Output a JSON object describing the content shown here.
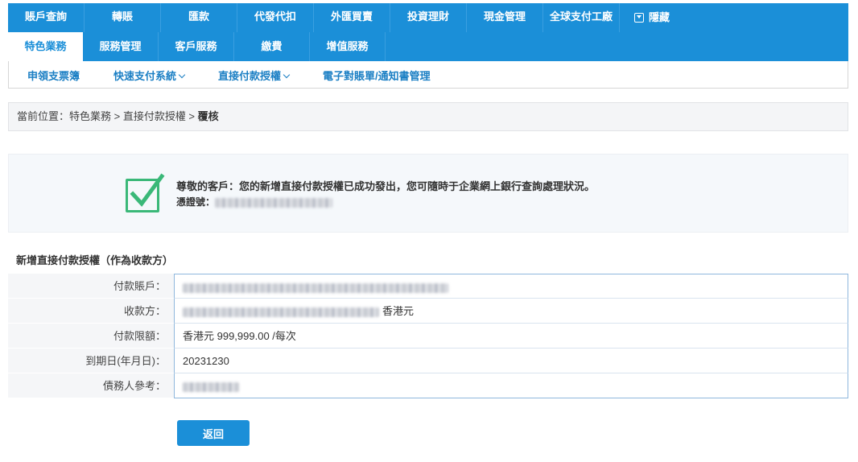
{
  "nav_primary": [
    "賬戶查詢",
    "轉賬",
    "匯款",
    "代發代扣",
    "外匯買賣",
    "投資理財",
    "現金管理",
    "全球支付工廠"
  ],
  "nav_primary_hide": "隱藏",
  "nav_secondary": [
    "特色業務",
    "服務管理",
    "客戶服務",
    "繳費",
    "增值服務"
  ],
  "nav_tertiary": {
    "item1": "申領支票簿",
    "item2": "快速支付系統",
    "item3": "直接付款授權",
    "item4": "電子對賬單/通知書管理"
  },
  "breadcrumb": {
    "prefix": "當前位置：特色業務 > 直接付款授權 > ",
    "current": "覆核"
  },
  "success": {
    "message": "尊敬的客戶：您的新增直接付款授權已成功發出，您可隨時于企業網上銀行查詢處理狀況。",
    "ref_label": "憑證號："
  },
  "form": {
    "title": "新增直接付款授權（作為收款方）",
    "rows": [
      {
        "label": "付款賬戶：",
        "value": ""
      },
      {
        "label": "收款方：",
        "value": "香港元"
      },
      {
        "label": "付款限額：",
        "value": "香港元 999,999.00 /每次"
      },
      {
        "label": "到期日(年月日)：",
        "value": "20231230"
      },
      {
        "label": "債務人參考：",
        "value": ""
      }
    ]
  },
  "back_label": "返回",
  "colors": {
    "accent": "#1b8fd8",
    "success": "#3ab878"
  }
}
